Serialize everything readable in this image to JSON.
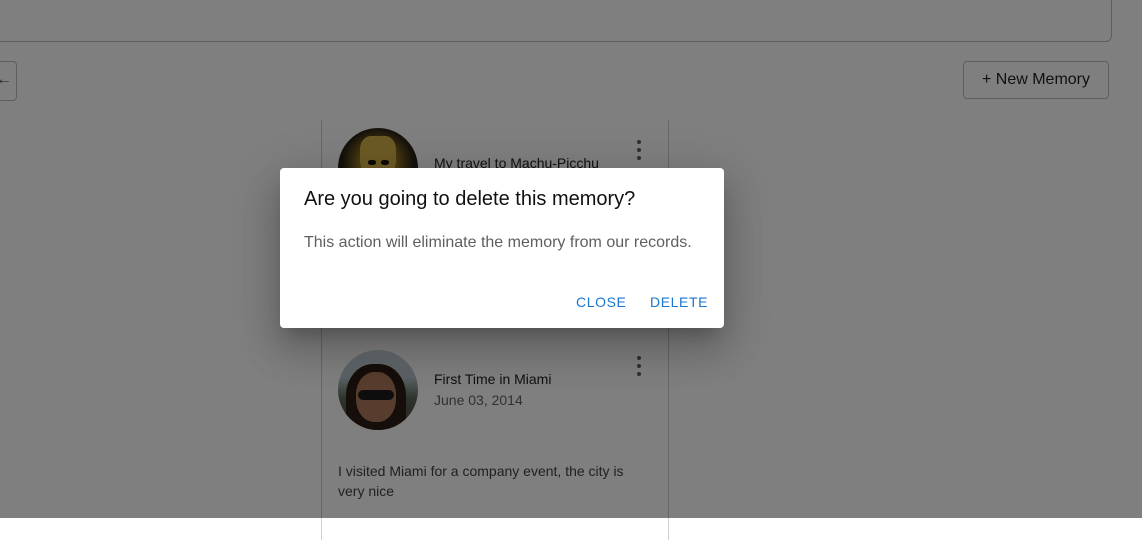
{
  "toolbar": {
    "left_button_glyph": "←",
    "new_memory_label": "+ New Memory"
  },
  "memories": [
    {
      "title": "My travel to Machu-Picchu",
      "date": "",
      "description": ""
    },
    {
      "title": "First Time in Miami",
      "date": "June 03, 2014",
      "description": "I visited Miami for a company event, the city is very nice"
    }
  ],
  "dialog": {
    "title": "Are you going to delete this memory?",
    "message": "This action will eliminate the memory from our records.",
    "close_label": "CLOSE",
    "delete_label": "DELETE"
  },
  "colors": {
    "accent": "#1976d2",
    "backdrop": "rgba(0,0,0,0.5)"
  }
}
